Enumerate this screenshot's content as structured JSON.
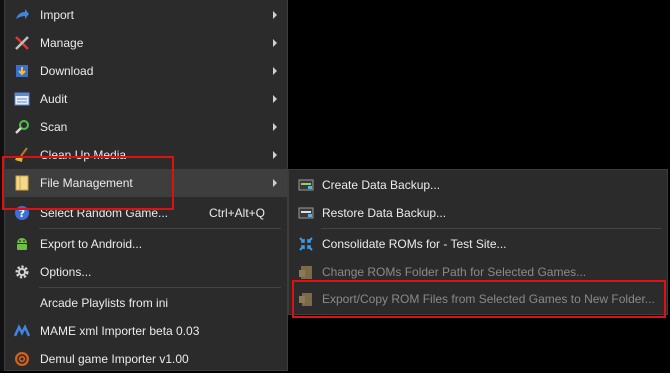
{
  "main_menu": {
    "items": [
      {
        "label": "Import",
        "icon": "import-arrow-icon",
        "submenu": true
      },
      {
        "label": "Manage",
        "icon": "tools-icon",
        "submenu": true
      },
      {
        "label": "Download",
        "icon": "download-icon",
        "submenu": true
      },
      {
        "label": "Audit",
        "icon": "audit-icon",
        "submenu": true
      },
      {
        "label": "Scan",
        "icon": "scan-icon",
        "submenu": true
      },
      {
        "label": "Clean Up Media",
        "icon": "broom-icon",
        "submenu": true
      },
      {
        "label": "File Management",
        "icon": "folder-icon",
        "submenu": true,
        "highlighted": true
      },
      {
        "label": "Select Random Game...",
        "icon": "help-icon",
        "shortcut": "Ctrl+Alt+Q"
      },
      {
        "label": "Export to Android...",
        "icon": "android-icon"
      },
      {
        "label": "Options...",
        "icon": "gear-icon"
      },
      {
        "label": "Arcade Playlists from ini",
        "icon": ""
      },
      {
        "label": "MAME xml Importer beta 0.03",
        "icon": "mame-icon"
      },
      {
        "label": "Demul game Importer v1.00",
        "icon": "demul-icon"
      }
    ]
  },
  "sub_menu": {
    "items": [
      {
        "label": "Create Data Backup...",
        "icon": "backup-icon"
      },
      {
        "label": "Restore Data Backup...",
        "icon": "restore-icon"
      },
      {
        "label": "Consolidate ROMs for - Test Site...",
        "icon": "consolidate-icon"
      },
      {
        "label": "Change ROMs Folder Path for Selected Games...",
        "icon": "change-folder-icon",
        "disabled": true
      },
      {
        "label": "Export/Copy ROM Files from Selected Games to New Folder...",
        "icon": "export-copy-icon",
        "disabled": true
      }
    ]
  },
  "colors": {
    "highlight_box": "#e01010",
    "menu_bg": "#2b2b2b",
    "disabled_text": "#8a8a8a"
  }
}
